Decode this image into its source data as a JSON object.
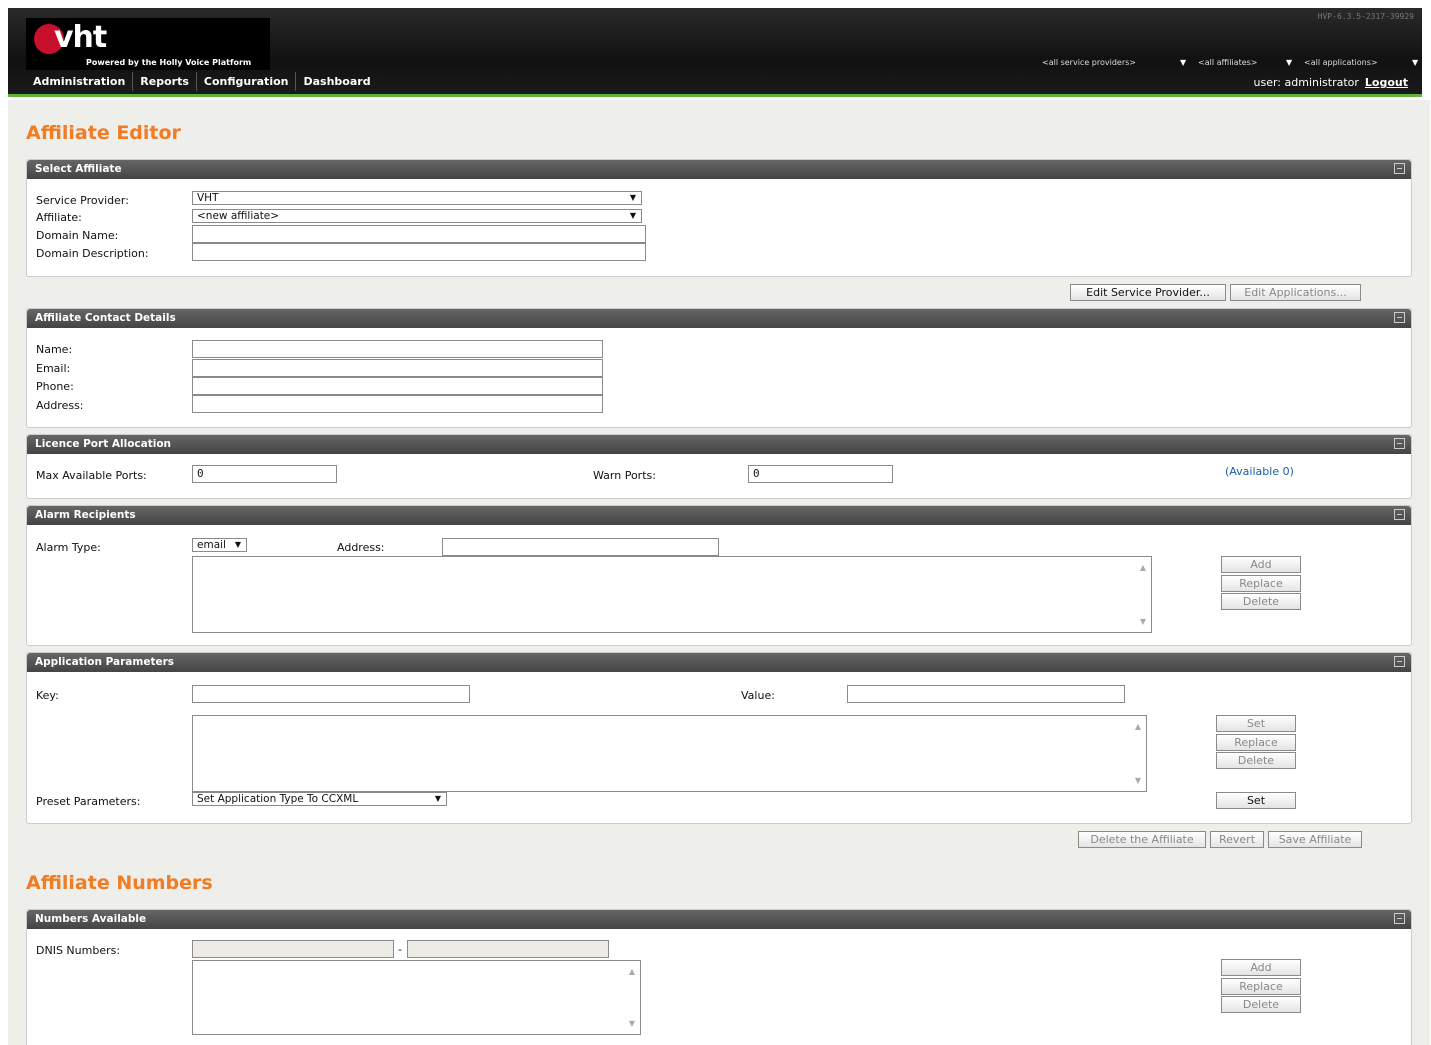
{
  "header": {
    "logo": {
      "mark": "vht",
      "tagline": "Powered by the Holly Voice Platform"
    },
    "version": "HVP-6.3.5-2317-39929",
    "nav": [
      "Administration",
      "Reports",
      "Configuration",
      "Dashboard"
    ],
    "filters": {
      "service_providers": "<all service providers>",
      "affiliates": "<all affiliates>",
      "applications": "<all applications>"
    },
    "user_label": "user: administrator",
    "logout": "Logout"
  },
  "affiliate_editor": {
    "title": "Affiliate Editor",
    "select_affiliate": {
      "heading": "Select Affiliate",
      "service_provider_label": "Service Provider:",
      "service_provider_value": "VHT",
      "affiliate_label": "Affiliate:",
      "affiliate_value": "<new affiliate>",
      "domain_name_label": "Domain Name:",
      "domain_name_value": "",
      "domain_description_label": "Domain Description:",
      "domain_description_value": ""
    },
    "edit_service_provider_button": "Edit Service Provider...",
    "edit_applications_button": "Edit Applications...",
    "contact": {
      "heading": "Affiliate Contact Details",
      "name_label": "Name:",
      "email_label": "Email:",
      "phone_label": "Phone:",
      "address_label": "Address:"
    },
    "licence": {
      "heading": "Licence Port Allocation",
      "max_label": "Max Available Ports:",
      "max_value": "0",
      "warn_label": "Warn Ports:",
      "warn_value": "0",
      "available": "(Available 0)"
    },
    "alarm": {
      "heading": "Alarm Recipients",
      "type_label": "Alarm Type:",
      "type_value": "email",
      "address_label": "Address:",
      "add": "Add",
      "replace": "Replace",
      "delete": "Delete"
    },
    "app_params": {
      "heading": "Application Parameters",
      "key_label": "Key:",
      "value_label": "Value:",
      "set": "Set",
      "replace": "Replace",
      "delete": "Delete",
      "preset_label": "Preset Parameters:",
      "preset_value": "Set Application Type To CCXML",
      "preset_set": "Set"
    },
    "delete_affiliate_button": "Delete the Affiliate",
    "revert_button": "Revert",
    "save_affiliate_button": "Save Affiliate"
  },
  "affiliate_numbers": {
    "title": "Affiliate Numbers",
    "numbers_available": {
      "heading": "Numbers Available",
      "dnis_label": "DNIS Numbers:",
      "range_separator": "-",
      "add": "Add",
      "replace": "Replace",
      "delete": "Delete"
    }
  }
}
